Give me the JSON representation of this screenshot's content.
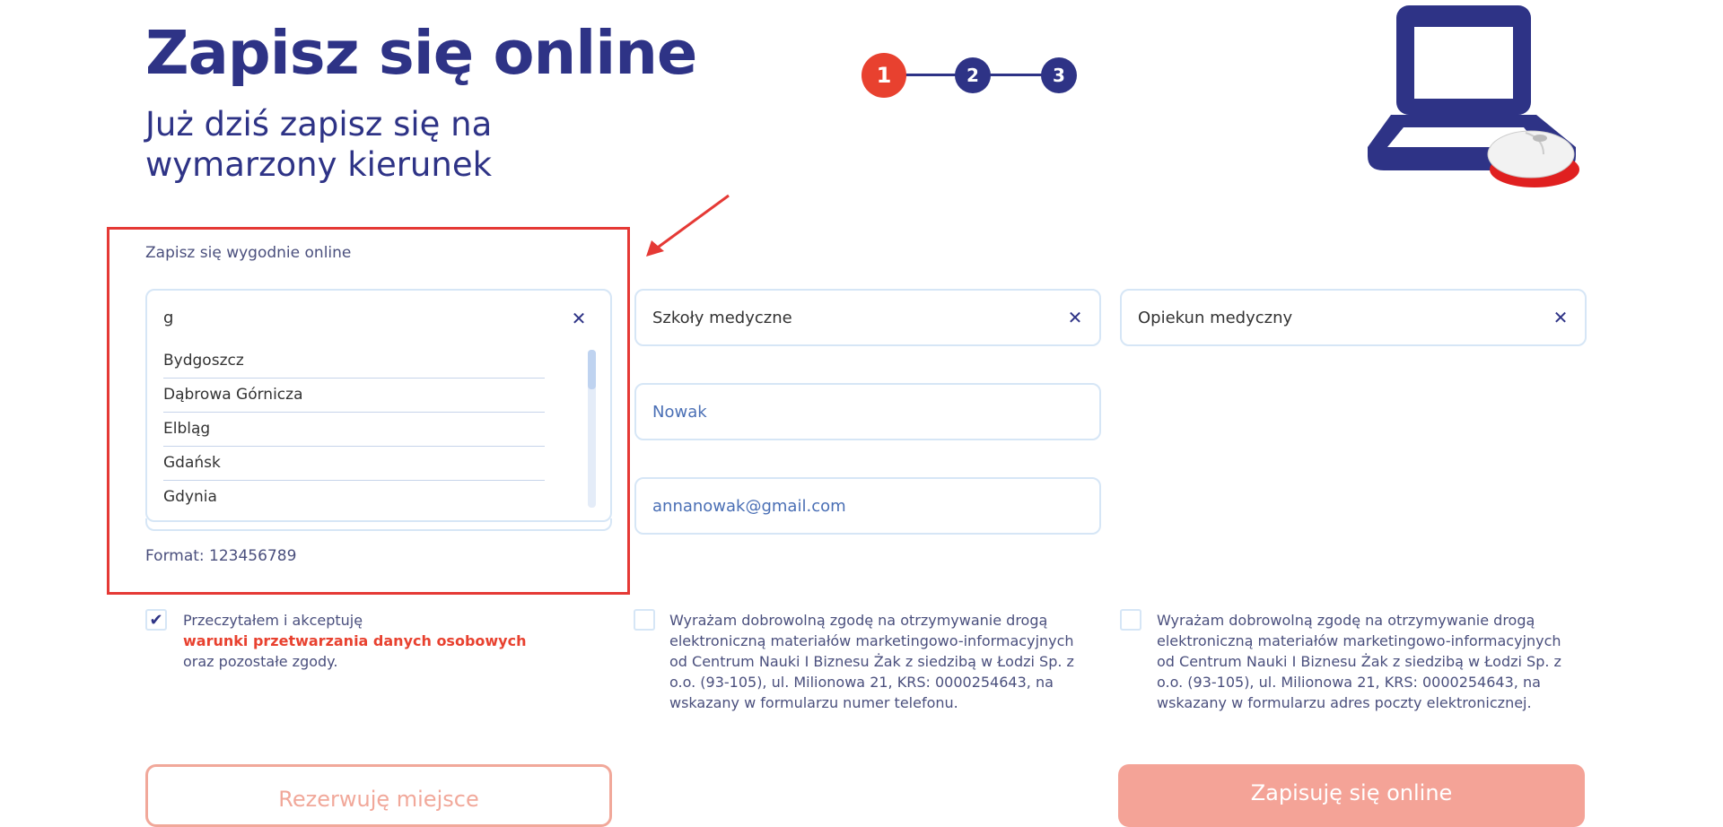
{
  "header": {
    "title": "Zapisz się online",
    "subtitle": "Już dziś zapisz się na wymarzony kierunek"
  },
  "stepper": {
    "steps": [
      "1",
      "2",
      "3"
    ],
    "active": "1"
  },
  "form": {
    "section_label": "Zapisz się wygodnie online",
    "city": {
      "search_value": "g",
      "options": [
        "Bydgoszcz",
        "Dąbrowa Górnicza",
        "Elbląg",
        "Gdańsk",
        "Gdynia"
      ]
    },
    "school_type": {
      "value": "Szkoły medyczne"
    },
    "course": {
      "value": "Opiekun medyczny"
    },
    "last_name": {
      "placeholder": "Nowak"
    },
    "email": {
      "placeholder": "annanowak@gmail.com"
    },
    "phone_format": "Format: 123456789"
  },
  "consents": {
    "terms": {
      "checked": true,
      "check_glyph": "✔",
      "line1": "Przeczytałem i akceptuję",
      "link": "warunki przetwarzania danych osobowych",
      "line2": "oraz pozostałe zgody."
    },
    "phone_marketing": {
      "checked": false,
      "text": "Wyrażam dobrowolną zgodę na otrzymywanie drogą elektroniczną materiałów marketingowo-informacyjnych od Centrum Nauki I Biznesu Żak z siedzibą w Łodzi Sp. z o.o. (93-105), ul. Milionowa 21, KRS: 0000254643, na wskazany w formularzu numer telefonu."
    },
    "email_marketing": {
      "checked": false,
      "text": "Wyrażam dobrowolną zgodę na otrzymywanie drogą elektroniczną materiałów marketingowo-informacyjnych od Centrum Nauki I Biznesu Żak z siedzibą w Łodzi Sp. z o.o. (93-105), ul. Milionowa 21, KRS: 0000254643, na wskazany w formularzu adres poczty elektronicznej."
    }
  },
  "buttons": {
    "reserve": "Rezerwuję miejsce",
    "submit": "Zapisuję się online"
  },
  "icons": {
    "clear": "close-icon",
    "laptop": "laptop-mouse-illustration",
    "arrow": "annotation-arrow"
  },
  "colors": {
    "brand_navy": "#2e3386",
    "accent_red": "#e8412f",
    "highlight_red": "#e53935",
    "field_border": "#d6e6f6"
  }
}
